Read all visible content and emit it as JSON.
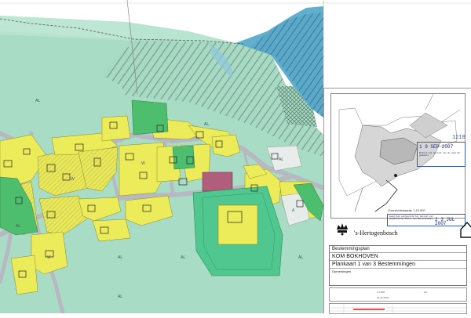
{
  "map": {
    "zone_labels": [
      "AL",
      "AL",
      "AL",
      "AL",
      "AL",
      "AL",
      "AL",
      "AL",
      "W",
      "W",
      "W",
      "A"
    ],
    "colors": {
      "agriculture": "#a6dcc6",
      "agriculture_light": "#b9e6d3",
      "residential": "#eeee5a",
      "residential_outline": "#8a8a2a",
      "green": "#4dbd6e",
      "water": "#64b0cf",
      "road": "#b5b5c0",
      "mixed": "#b0607a",
      "hatch": "#6f9a8a"
    }
  },
  "inset": {
    "label": "Overzichtskaartje 1:15.000"
  },
  "stamps": {
    "date1": "1 9 SEP 2007",
    "date2": "2 3 JUL 2007",
    "approve_text": "Gewijzigd vastgesteld bij besluit van Gedeputeerde Staten van Noord-Brabant",
    "approve_text2": "Behoort bij besluit van de raad der gemeente",
    "ref": "1218"
  },
  "header": {
    "org": "'s-Hertogenbosch"
  },
  "title_block": {
    "label": "Bestemmingsplan",
    "name": "KOM BOKHOVEN",
    "sheet": "Plankaart 1 van 3  Bestemmingen",
    "notes_label": "Opmerkingen"
  },
  "meta": {
    "scale": "1:2.500",
    "format": "A0",
    "date": "26-11-2004"
  }
}
